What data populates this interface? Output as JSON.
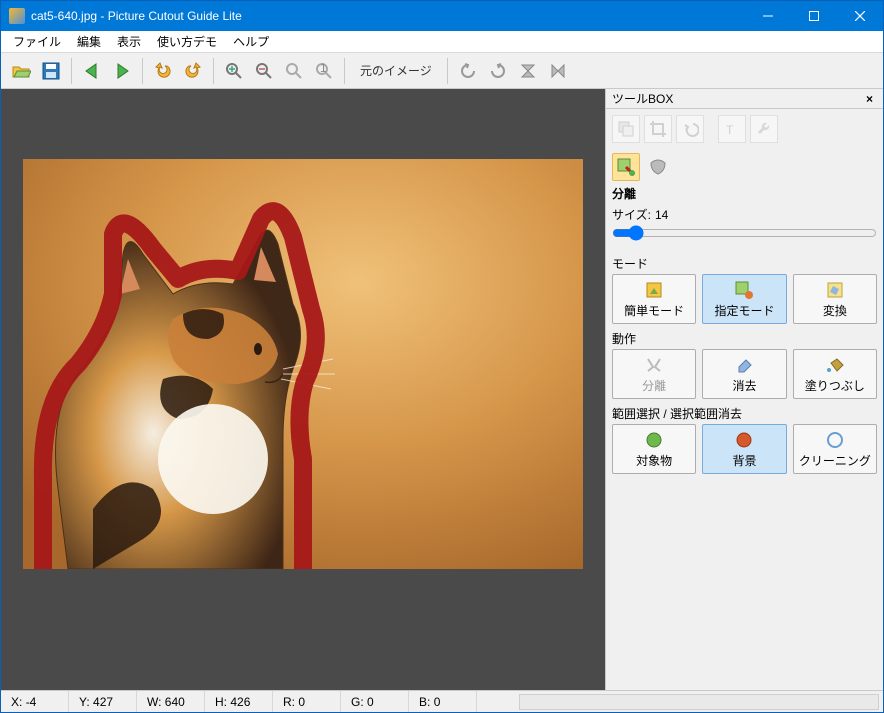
{
  "window": {
    "title": "cat5-640.jpg - Picture Cutout Guide Lite"
  },
  "menu": {
    "file": "ファイル",
    "edit": "編集",
    "view": "表示",
    "demo": "使い方デモ",
    "help": "ヘルプ"
  },
  "toolbar": {
    "original_image": "元のイメージ"
  },
  "toolbox": {
    "title": "ツールBOX",
    "section_separate": "分離",
    "size_label": "サイズ:",
    "size_value": "14",
    "mode_label": "モード",
    "mode_simple": "簡単モード",
    "mode_specified": "指定モード",
    "mode_transform": "変換",
    "action_label": "動作",
    "action_separate": "分離",
    "action_erase": "消去",
    "action_fill": "塗りつぶし",
    "range_label": "範囲選択 / 選択範囲消去",
    "range_object": "対象物",
    "range_background": "背景",
    "range_cleaning": "クリーニング"
  },
  "status": {
    "x_label": "X:",
    "x_value": "-4",
    "y_label": "Y:",
    "y_value": "427",
    "w_label": "W:",
    "w_value": "640",
    "h_label": "H:",
    "h_value": "426",
    "r_label": "R:",
    "r_value": "0",
    "g_label": "G:",
    "g_value": "0",
    "b_label": "B:",
    "b_value": "0"
  },
  "colors": {
    "titlebar": "#0078d7",
    "stroke": "#c02020"
  }
}
